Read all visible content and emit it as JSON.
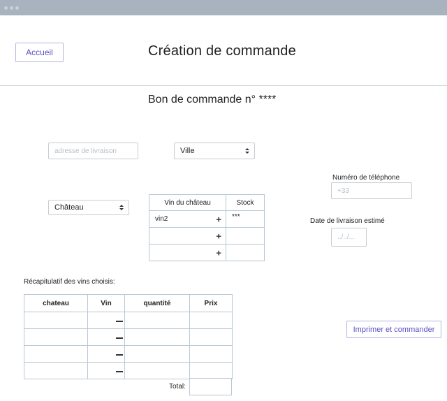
{
  "header": {
    "home_button": "Accueil",
    "page_title": "Création de commande"
  },
  "order": {
    "title": "Bon de commande n° ****"
  },
  "form": {
    "address_placeholder": "adresse de livraison",
    "city_select": "Ville",
    "phone_label": "Numéro de téléphone",
    "phone_placeholder": "+33",
    "chateau_select": "Château",
    "delivery_label": "Date de livraison estimé",
    "delivery_placeholder": "../../...",
    "print_button": "Imprimer et commander"
  },
  "wine_table": {
    "headers": [
      "Vin du château",
      "Stock"
    ],
    "rows": [
      {
        "wine": "vin2",
        "stock": "***"
      },
      {
        "wine": "",
        "stock": ""
      },
      {
        "wine": "",
        "stock": ""
      }
    ],
    "add_symbol": "+"
  },
  "summary": {
    "label": "Récapitulatif des vins choisis:",
    "headers": [
      "chateau",
      "Vin",
      "quantité",
      "Prix"
    ],
    "row_count": 4,
    "total_label": "Total:"
  },
  "icons": {
    "select_caret": "up-down-caret-icon",
    "add": "plus-icon",
    "remove": "minus-icon"
  }
}
